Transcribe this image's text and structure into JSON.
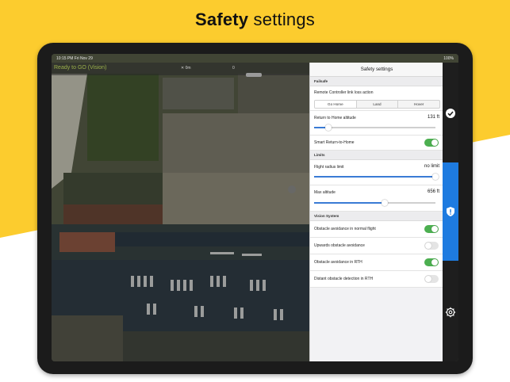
{
  "headline": {
    "bold": "Safety",
    "rest": " settings"
  },
  "colors": {
    "yellow": "#fccc2e",
    "accent_blue": "#1e7be0",
    "toggle_on": "#4caf50",
    "slider": "#3a7bd5"
  },
  "status_bar": {
    "time": "10:15 PM  Fri Nov 29",
    "battery": "100%"
  },
  "top_bar": {
    "status": "Ready to GO (Vision)",
    "distance": "0m",
    "signal": "0"
  },
  "panel": {
    "title": "Safety settings",
    "failsafe": {
      "header": "Failsafe",
      "link_loss_label": "Remote Controller link loss action",
      "options": [
        "Go Home",
        "Land",
        "Hover"
      ],
      "selected": "Go Home",
      "rth_altitude_label": "Return to Home altitude",
      "rth_altitude_value": "131 ft",
      "rth_altitude_fraction": 0.12,
      "smart_rth_label": "Smart Return-to-Home",
      "smart_rth_on": true
    },
    "limits": {
      "header": "Limits",
      "radius_label": "Flight radius limit",
      "radius_value": "no limit",
      "radius_fraction": 1.0,
      "max_alt_label": "Max altitude",
      "max_alt_value": "656 ft",
      "max_alt_fraction": 0.58
    },
    "vision": {
      "header": "Vision System",
      "items": [
        {
          "label": "Obstacle avoidance in normal flight",
          "on": true
        },
        {
          "label": "Upwards obstacle avoidance",
          "on": false
        },
        {
          "label": "Obstacle avoidance in RTH",
          "on": true
        },
        {
          "label": "Distant obstacle detection in RTH",
          "on": false
        }
      ]
    }
  },
  "right_rail": {
    "icons": [
      "checkmark-icon",
      "shield-alert-icon",
      "gear-icon"
    ]
  }
}
